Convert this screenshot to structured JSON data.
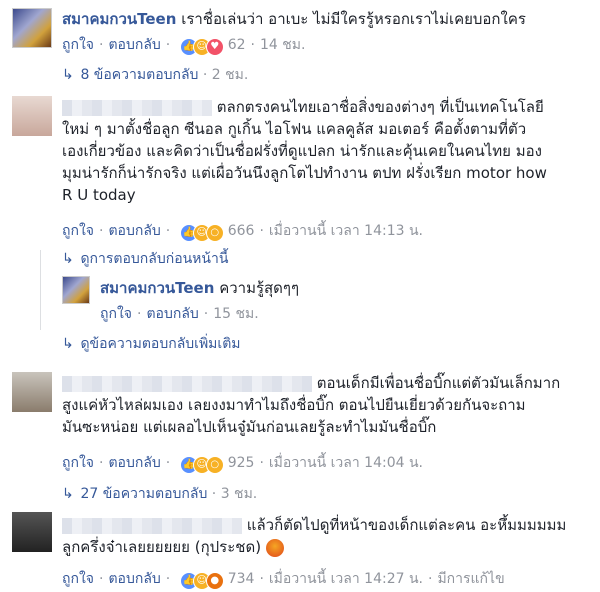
{
  "comments": [
    {
      "name": "สมาคมกวนTeen",
      "text": "เราชื่อเล่นว่า อาเบะ ไม่มีใครรู้หรอกเราไม่เคยบอกใคร",
      "like": "ถูกใจ",
      "reply": "ตอบกลับ",
      "reactions": [
        "like",
        "haha",
        "love"
      ],
      "count": "62",
      "time": "14 ชม.",
      "replies_link": "8 ข้อความตอบกลับ",
      "replies_time": "2 ชม."
    },
    {
      "name_redacted": true,
      "text_l1": "ตลกตรงคนไทยเอาชื่อสิ่งของต่างๆ ที่เป็นเทคโนโลยี",
      "text_l2": "ใหม่ ๆ มาตั้งชื่อลูก ซีนอล กูเกิ้น ไอโฟน แคลคูลัส มอเตอร์ คือตั้งตามที่ตัว",
      "text_l3": "เองเกี่ยวข้อง และคิดว่าเป็นชื่อฝรั่งที่ดูแปลก น่ารักและคุ้นเคยในคนไทย มอง",
      "text_l4": "มุมน่ารักก็น่ารักจริง แต่เผื่อวันนึงลูกโตไปทำงาน ตปท ฝรั่งเรียก motor how",
      "text_l5": "R U today",
      "like": "ถูกใจ",
      "reply": "ตอบกลับ",
      "reactions": [
        "like",
        "haha",
        "wow"
      ],
      "count": "666",
      "time": "เมื่อวานนี้ เวลา 14:13 น.",
      "prev_link": "ดูการตอบกลับก่อนหน้านี้",
      "nested": {
        "name": "สมาคมกวนTeen",
        "text": "ความรู้สุดๆๆ",
        "like": "ถูกใจ",
        "reply": "ตอบกลับ",
        "time": "15 ชม."
      },
      "more_link": "ดูข้อความตอบกลับเพิ่มเติม"
    },
    {
      "name_redacted": true,
      "text_l1": "ตอนเด็กมีเพื่อนชื่อบิ๊กแต่ตัวมันเล็กมาก",
      "text_l2": "สูงแค่หัวไหล่ผมเอง เลยงงมาทำไมถึงชื่อบิ๊ก ตอนไปยืนเยี่ยวด้วยกันจะถาม",
      "text_l3": "มันซะหน่อย แต่เผลอไปเห็นจู๋มันก่อนเลยรู้ละทำไมมันชื่อบิ๊ก",
      "like": "ถูกใจ",
      "reply": "ตอบกลับ",
      "reactions": [
        "like",
        "haha",
        "wow"
      ],
      "count": "925",
      "time": "เมื่อวานนี้ เวลา 14:04 น.",
      "replies_link": "27 ข้อความตอบกลับ",
      "replies_time": "3 ชม."
    },
    {
      "name_redacted": true,
      "text_l1": "แล้วก็ตัดไปดูที่หน้าของเด็กแต่ละคน อะหึ้มมมมมม",
      "text_l2": "ลูกครึ่งจ๋าเลยยยยยย (กุประชด)",
      "like": "ถูกใจ",
      "reply": "ตอบกลับ",
      "reactions": [
        "like",
        "haha",
        "angry"
      ],
      "count": "734",
      "time": "เมื่อวานนี้ เวลา 14:27 น.",
      "edited": "มีการแก้ไข"
    }
  ]
}
